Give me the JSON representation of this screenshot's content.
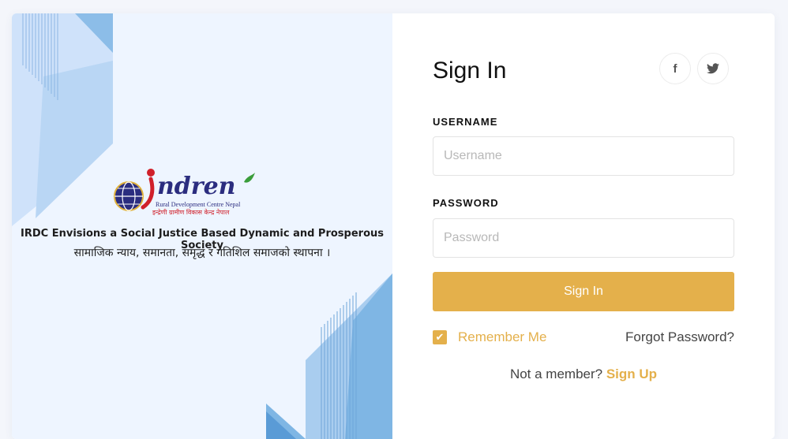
{
  "brand": {
    "logo_text": "ndren",
    "logo_subtitle_en": "Rural Development Centre Nepal",
    "logo_subtitle_np": "इन्द्रेणी ग्रामीण विकास केन्द्र नेपाल",
    "tagline_en": "IRDC Envisions a Social Justice Based Dynamic and Prosperous Society",
    "tagline_np": "सामाजिक न्याय, समानता, समृद्ध र गतिशिल समाजको स्थापना ।"
  },
  "form": {
    "title": "Sign In",
    "username_label": "USERNAME",
    "username_placeholder": "Username",
    "username_value": "",
    "password_label": "PASSWORD",
    "password_placeholder": "Password",
    "password_value": "",
    "submit_label": "Sign In",
    "remember_label": "Remember Me",
    "remember_checked": true,
    "forgot_label": "Forgot Password?",
    "member_prompt": "Not a member?",
    "signup_label": "Sign Up"
  },
  "social": [
    {
      "name": "facebook-icon",
      "glyph": "f"
    },
    {
      "name": "twitter-icon",
      "glyph": "🐦"
    }
  ],
  "colors": {
    "accent": "#e4b04b",
    "panel_bg": "#eef5ff",
    "logo_red": "#d0202a",
    "logo_blue": "#2b2d7f"
  }
}
